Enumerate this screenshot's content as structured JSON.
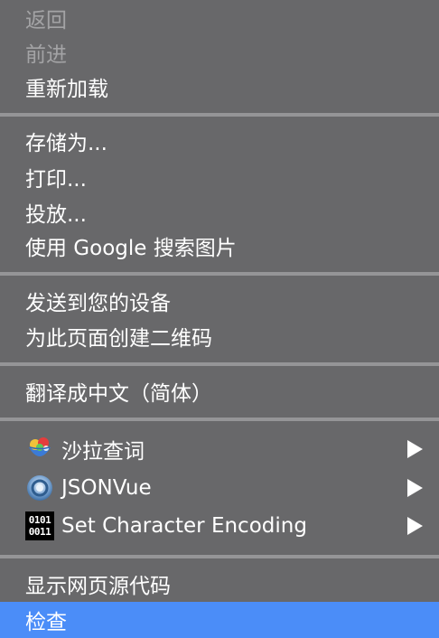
{
  "menu": {
    "nav": {
      "back": "返回",
      "forward": "前进",
      "reload": "重新加载"
    },
    "page": {
      "save_as": "存储为...",
      "print": "打印...",
      "cast": "投放...",
      "search_image": "使用 Google 搜索图片"
    },
    "share": {
      "send_to_devices": "发送到您的设备",
      "create_qr": "为此页面创建二维码"
    },
    "translate": {
      "label": "翻译成中文（简体）"
    },
    "extensions": [
      {
        "label": "沙拉查词",
        "icon": "saladict-icon"
      },
      {
        "label": "JSONVue",
        "icon": "jsonvue-icon"
      },
      {
        "label": "Set Character Encoding",
        "icon": "binary-encoding-icon",
        "icon_text": [
          "0101",
          "0011"
        ]
      }
    ],
    "dev": {
      "view_source": "显示网页源代码",
      "inspect": "检查"
    },
    "colors": {
      "background": "#68686a",
      "separator": "#959597",
      "disabled_text": "#a3a3a5",
      "highlight": "#4b8df8"
    }
  }
}
